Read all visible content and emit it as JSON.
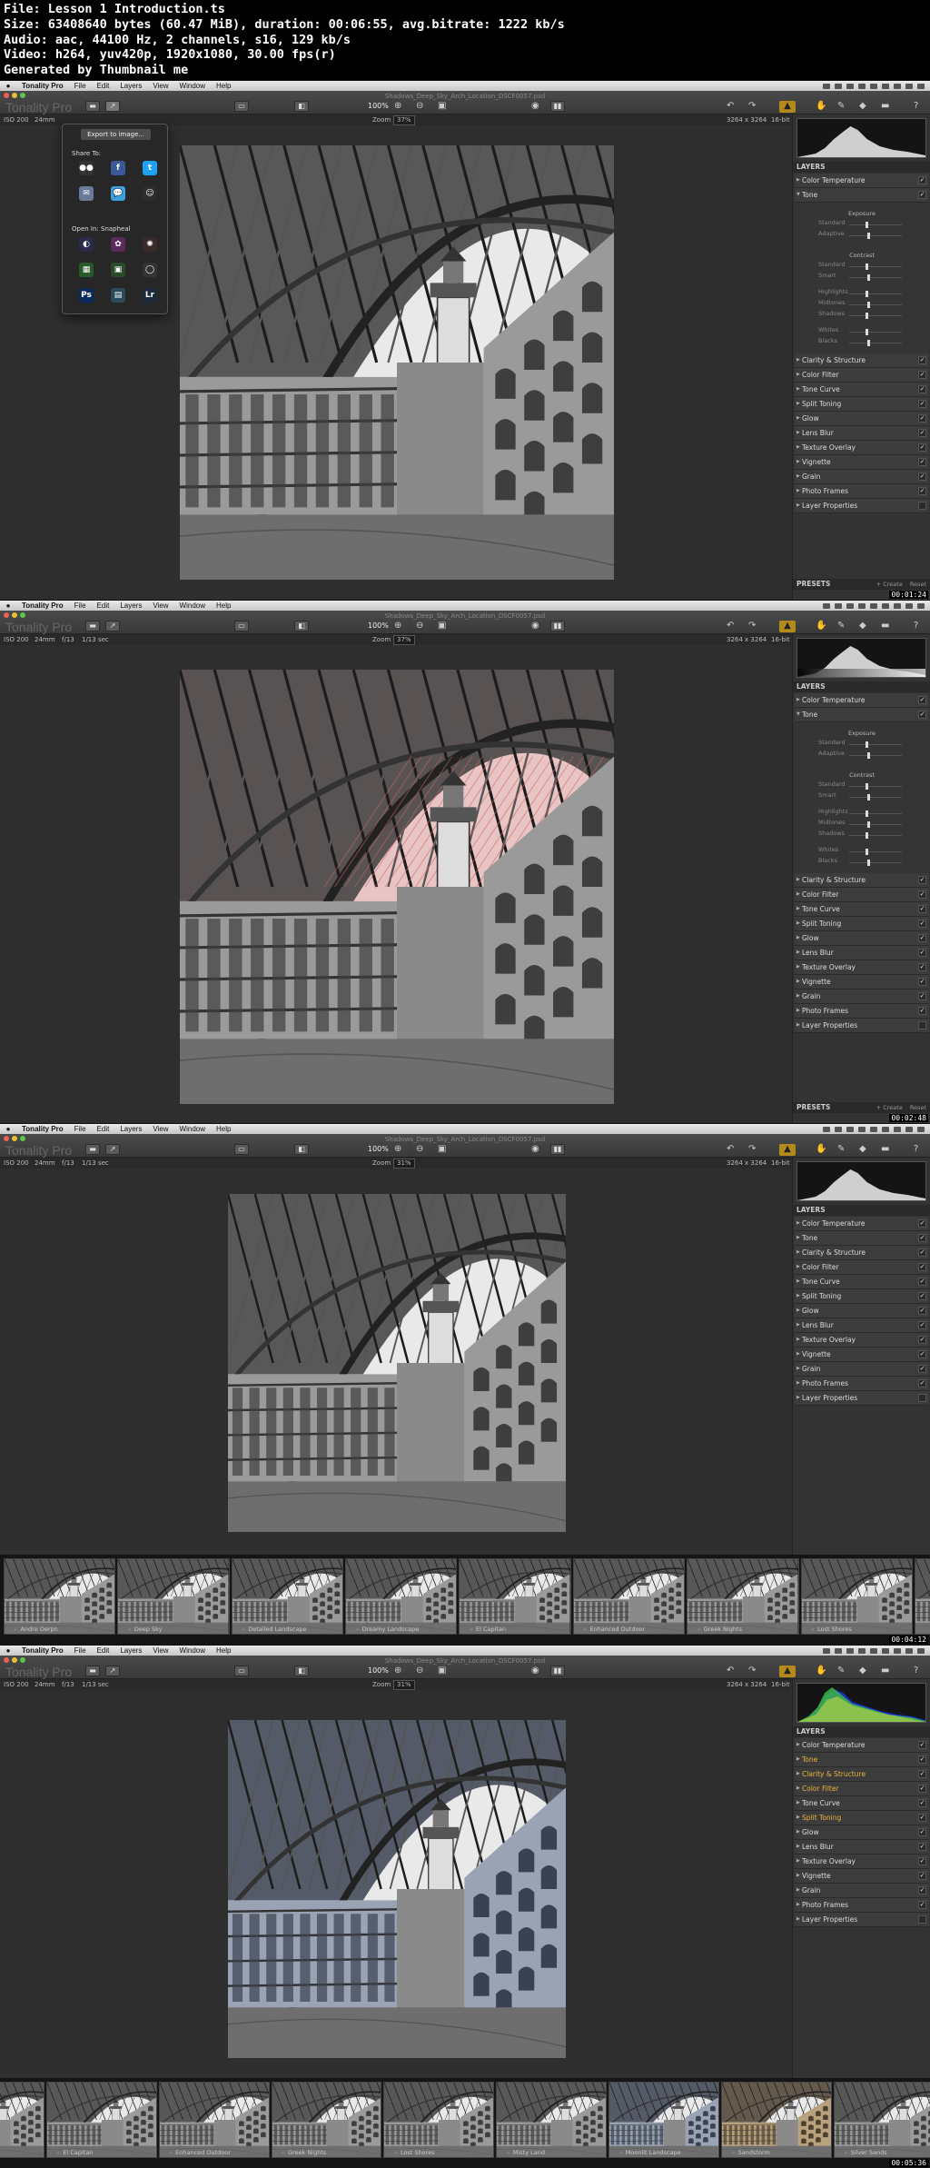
{
  "header": {
    "lines": [
      "File: Lesson 1 Introduction.ts",
      "Size: 63408640 bytes (60.47 MiB), duration: 00:06:55, avg.bitrate: 1222 kb/s",
      "Audio: aac, 44100 Hz, 2 channels, s16, 129 kb/s",
      "Video: h264, yuv420p, 1920x1080, 30.00 fps(r)",
      "Generated by Thumbnail me"
    ]
  },
  "menubar": {
    "app": "Tonality Pro",
    "items": [
      "File",
      "Edit",
      "Layers",
      "View",
      "Window",
      "Help"
    ]
  },
  "toolbar": {
    "app_name": "Tonality Pro",
    "zoom_100": "100%",
    "doc_title": "Shadows_Deep_Sky_Arch_Location_DSCF0057.psd"
  },
  "infobar": {
    "iso": "ISO 200",
    "focal": "24mm",
    "aperture": "f/13",
    "shutter": "1/13 sec",
    "zoom_label": "Zoom",
    "dimensions": "3264 x 3264",
    "bit": "16-bit"
  },
  "frames": [
    {
      "zoom": "37%",
      "timecode": "00:01:24"
    },
    {
      "zoom": "37%",
      "timecode": "00:02:48"
    },
    {
      "zoom": "31%",
      "timecode": "00:04:12"
    },
    {
      "zoom": "31%",
      "timecode": "00:05:36"
    }
  ],
  "share_popover": {
    "export_label": "Export to image...",
    "share_to": "Share To:",
    "open_in": "Open In: Snapheal",
    "share_icons": [
      "flickr-icon",
      "facebook-icon",
      "twitter-icon",
      "mail-icon",
      "messages-icon",
      "smugmug-icon"
    ],
    "open_icons": [
      "aperture-icon",
      "intensify-icon",
      "focus-icon",
      "photos-icon",
      "iphoto-icon",
      "snapheal-icon",
      "photoshop-icon",
      "pixelmator-icon",
      "lightroom-icon"
    ]
  },
  "panel": {
    "layers_title": "LAYERS",
    "presets_title": "PRESETS",
    "create_label": "+ Create",
    "reset_label": "Reset",
    "preset_selected": "Outdoor",
    "layers": [
      "Color Temperature",
      "Tone",
      "Clarity & Structure",
      "Color Filter",
      "Tone Curve",
      "Split Toning",
      "Glow",
      "Lens Blur",
      "Texture Overlay",
      "Vignette",
      "Grain",
      "Photo Frames",
      "Layer Properties"
    ],
    "tone_panel": {
      "exposure": "Exposure",
      "exposure_rows": [
        "Standard",
        "Adaptive"
      ],
      "contrast": "Contrast",
      "contrast_rows": [
        "Standard",
        "Smart"
      ],
      "tone_rows": [
        "Highlights",
        "Midtones",
        "Shadows"
      ],
      "wb_rows": [
        "Whites",
        "Blacks"
      ]
    }
  },
  "filmstrip_1": [
    "Andre Oerpn",
    "Deep Sky",
    "Detailed Landscape",
    "Dreamy Landscape",
    "El Capitan",
    "Enhanced Outdoor",
    "Greek Nights",
    "Lost Shores"
  ],
  "filmstrip_2": [
    "El Capitan",
    "Enhanced Outdoor",
    "Greek Nights",
    "Lost Shores",
    "Misty Land",
    "Moonlit Landscape",
    "Sandstorm",
    "Silver Sands"
  ]
}
